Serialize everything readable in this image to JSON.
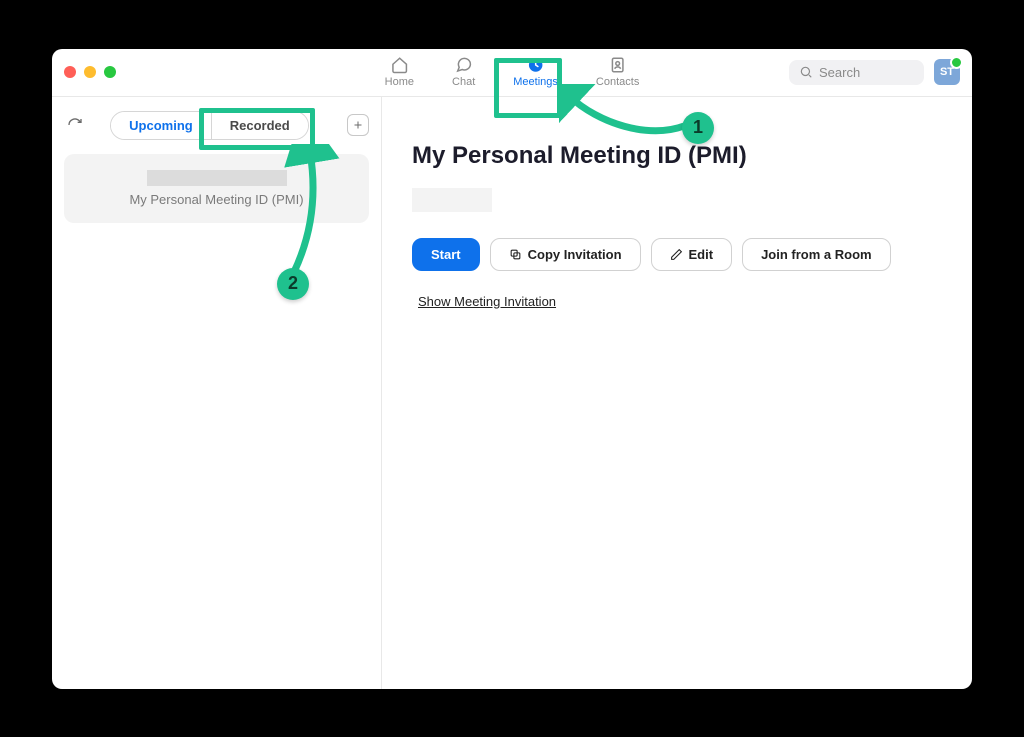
{
  "nav": {
    "home": "Home",
    "chat": "Chat",
    "meetings": "Meetings",
    "contacts": "Contacts"
  },
  "search": {
    "placeholder": "Search"
  },
  "avatar": {
    "initials": "ST"
  },
  "sidebar": {
    "segments": {
      "upcoming": "Upcoming",
      "recorded": "Recorded"
    },
    "item": {
      "label": "My Personal Meeting ID (PMI)"
    }
  },
  "content": {
    "title": "My Personal Meeting ID (PMI)",
    "buttons": {
      "start": "Start",
      "copy": "Copy Invitation",
      "edit": "Edit",
      "joinRoom": "Join from a Room"
    },
    "showInvitation": "Show Meeting Invitation"
  },
  "annotations": {
    "one": "1",
    "two": "2"
  }
}
